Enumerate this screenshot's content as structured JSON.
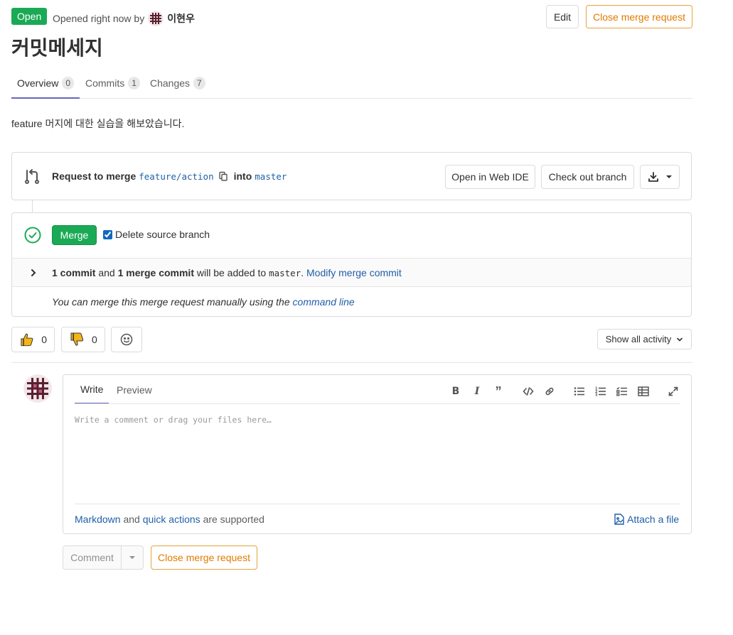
{
  "header": {
    "status": "Open",
    "opened_text": "Opened right now by",
    "author": "이현우",
    "edit_label": "Edit",
    "close_label": "Close merge request"
  },
  "title": "커밋메세지",
  "tabs": [
    {
      "label": "Overview",
      "count": "0"
    },
    {
      "label": "Commits",
      "count": "1"
    },
    {
      "label": "Changes",
      "count": "7"
    }
  ],
  "description": "feature 머지에 대한 실습을 해보았습니다.",
  "mr_widget": {
    "request_prefix": "Request to merge",
    "source_branch": "feature/action",
    "into_label": "into",
    "target_branch": "master",
    "web_ide_label": "Open in Web IDE",
    "checkout_label": "Check out branch"
  },
  "merge": {
    "button_label": "Merge",
    "delete_source_label": "Delete source branch",
    "delete_source_checked": true,
    "commit_count": "1 commit",
    "and": "and",
    "merge_commit_count": "1 merge commit",
    "will_be_added": "will be added to",
    "target": "master",
    "modify_link": "Modify merge commit",
    "manual_text": "You can merge this merge request manually using the",
    "command_line_link": "command line"
  },
  "awards": {
    "thumbs_up": "0",
    "thumbs_down": "0"
  },
  "activity_filter": "Show all activity",
  "comment": {
    "tab_write": "Write",
    "tab_preview": "Preview",
    "placeholder": "Write a comment or drag your files here…",
    "markdown_link": "Markdown",
    "and": "and",
    "quick_actions_link": "quick actions",
    "supported": "are supported",
    "attach_label": "Attach a file",
    "submit_label": "Comment",
    "close_label": "Close merge request"
  },
  "colors": {
    "success": "#1aaa55",
    "link": "#1f5fa8",
    "warning_border": "#e6a23c",
    "tab_active": "#6666c4"
  }
}
